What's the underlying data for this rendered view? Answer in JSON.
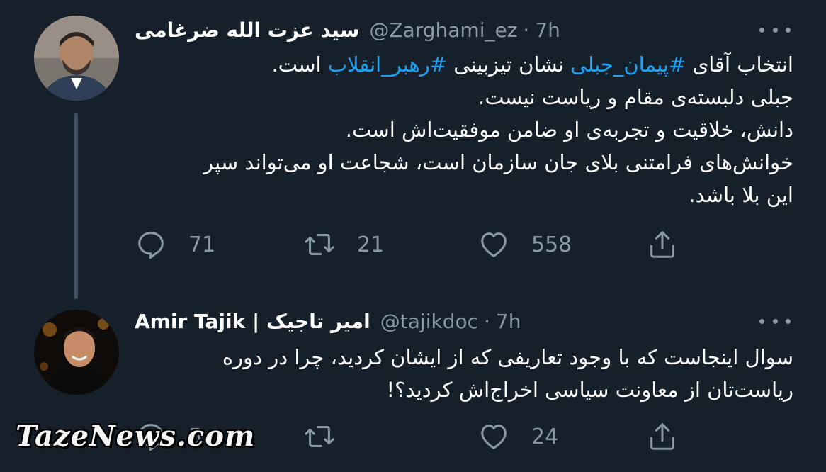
{
  "tweet1": {
    "name": "سید عزت الله ضرغامی",
    "handle": "@Zarghami_ez",
    "dot": "·",
    "time": "7h",
    "body": {
      "l1_a": "انتخاب آقای ",
      "l1_tag1": "#پیمان_جبلی",
      "l1_b": " نشان تیزبینی ",
      "l1_tag2": "#رهبر_انقلاب",
      "l1_c": " است.",
      "l2": "جبلی دلبسته‌ی مقام و ریاست نیست.",
      "l3": "دانش، خلاقیت و تجربه‌ی او ضامن موفقیت‌اش است.",
      "l4": "خوانش‌های فرامتنی بلای جان سازمان است، شجاعت او می‌تواند سپر",
      "l5": "این بلا باشد."
    },
    "actions": {
      "replies": "71",
      "retweets": "21",
      "likes": "558"
    }
  },
  "tweet2": {
    "name": "Amir Tajik | امیر تاجیک",
    "handle": "@tajikdoc",
    "dot": "·",
    "time": "7h",
    "body": {
      "l1": "سوال اینجاست که با وجود تعاریفی که از ایشان کردید، چرا در دوره",
      "l2": "ریاست‌تان از معاونت سیاسی اخراج‌اش کردید؟!"
    },
    "actions": {
      "replies": "5",
      "retweets": "",
      "likes": "24"
    }
  },
  "icons": [
    "reply-icon",
    "retweet-icon",
    "like-icon",
    "share-icon",
    "more-icon"
  ],
  "colors": {
    "background": "#15202b",
    "link": "#1da1f2",
    "muted": "#8899a6",
    "thread_line": "#3d5466"
  },
  "watermark": "TazeNews.com"
}
